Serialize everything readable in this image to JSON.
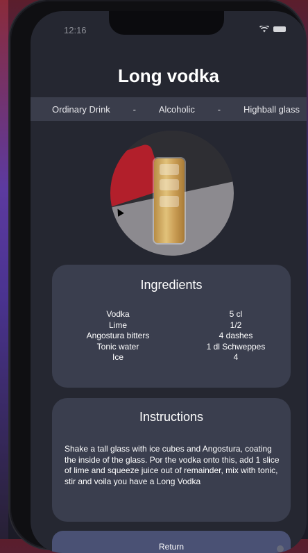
{
  "status_bar": {
    "time": "12:16"
  },
  "drink": {
    "name": "Long vodka",
    "category": "Ordinary Drink",
    "separator": "-",
    "alcoholic": "Alcoholic",
    "glass": "Highball glass"
  },
  "ingredients": {
    "title": "Ingredients",
    "items": [
      {
        "name": "Vodka",
        "measure": "5 cl"
      },
      {
        "name": "Lime",
        "measure": "1/2"
      },
      {
        "name": "Angostura bitters",
        "measure": "4 dashes"
      },
      {
        "name": "Tonic water",
        "measure": "1 dl Schweppes"
      },
      {
        "name": "Ice",
        "measure": "4"
      }
    ]
  },
  "instructions": {
    "title": "Instructions",
    "text": "Shake a tall glass with ice cubes and Angostura, coating the inside of the glass. Por the vodka onto this, add 1 slice of lime and squeeze juice out of remainder, mix with tonic, stir and voila you have a Long Vodka"
  },
  "actions": {
    "return_label": "Return"
  },
  "icons": {
    "status": [
      "wifi-icon",
      "battery-icon"
    ],
    "photo_cursor": "cursor-icon"
  },
  "colors": {
    "screen_bg": "#252731",
    "card_bg": "#3a3e4e",
    "meta_bar_bg": "#3a3d4b",
    "button_bg": "#4a5174"
  }
}
